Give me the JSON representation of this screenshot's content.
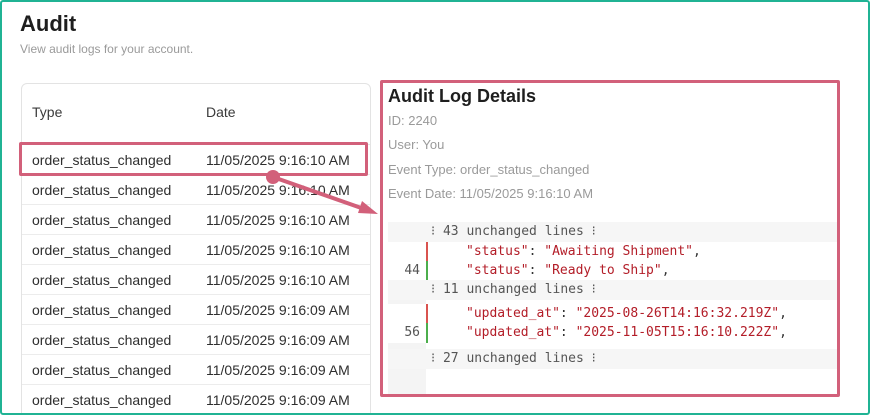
{
  "page": {
    "title": "Audit",
    "subtitle": "View audit logs for your account."
  },
  "table": {
    "headers": {
      "type": "Type",
      "date": "Date"
    },
    "rows": [
      {
        "type": "order_status_changed",
        "date": "11/05/2025 9:16:10 AM"
      },
      {
        "type": "order_status_changed",
        "date": "11/05/2025 9:16:10 AM"
      },
      {
        "type": "order_status_changed",
        "date": "11/05/2025 9:16:10 AM"
      },
      {
        "type": "order_status_changed",
        "date": "11/05/2025 9:16:10 AM"
      },
      {
        "type": "order_status_changed",
        "date": "11/05/2025 9:16:10 AM"
      },
      {
        "type": "order_status_changed",
        "date": "11/05/2025 9:16:09 AM"
      },
      {
        "type": "order_status_changed",
        "date": "11/05/2025 9:16:09 AM"
      },
      {
        "type": "order_status_changed",
        "date": "11/05/2025 9:16:09 AM"
      },
      {
        "type": "order_status_changed",
        "date": "11/05/2025 9:16:09 AM"
      }
    ]
  },
  "details": {
    "title": "Audit Log Details",
    "id": "ID: 2240",
    "user": "User: You",
    "event_type": "Event Type: order_status_changed",
    "event_date": "Event Date: 11/05/2025 9:16:10 AM",
    "diff": {
      "collapsed_1": "⁝ 43 unchanged lines ⁝",
      "status_key": "\"status\"",
      "status_old": "\"Awaiting Shipment\"",
      "status_new": "\"Ready to Ship\"",
      "line_44": "44",
      "collapsed_2": "⁝ 11 unchanged lines ⁝",
      "updated_key": "\"updated_at\"",
      "updated_old": "\"2025-08-26T14:16:32.219Z\"",
      "updated_new": "\"2025-11-05T15:16:10.222Z\"",
      "line_56": "56",
      "collapsed_3": "⁝ 27 unchanged lines ⁝"
    }
  },
  "colors": {
    "highlight": "#d2607a",
    "frame": "#20b394",
    "removed_marker": "#d9534f",
    "added_marker": "#4cae4c",
    "string": "#b31d28"
  }
}
